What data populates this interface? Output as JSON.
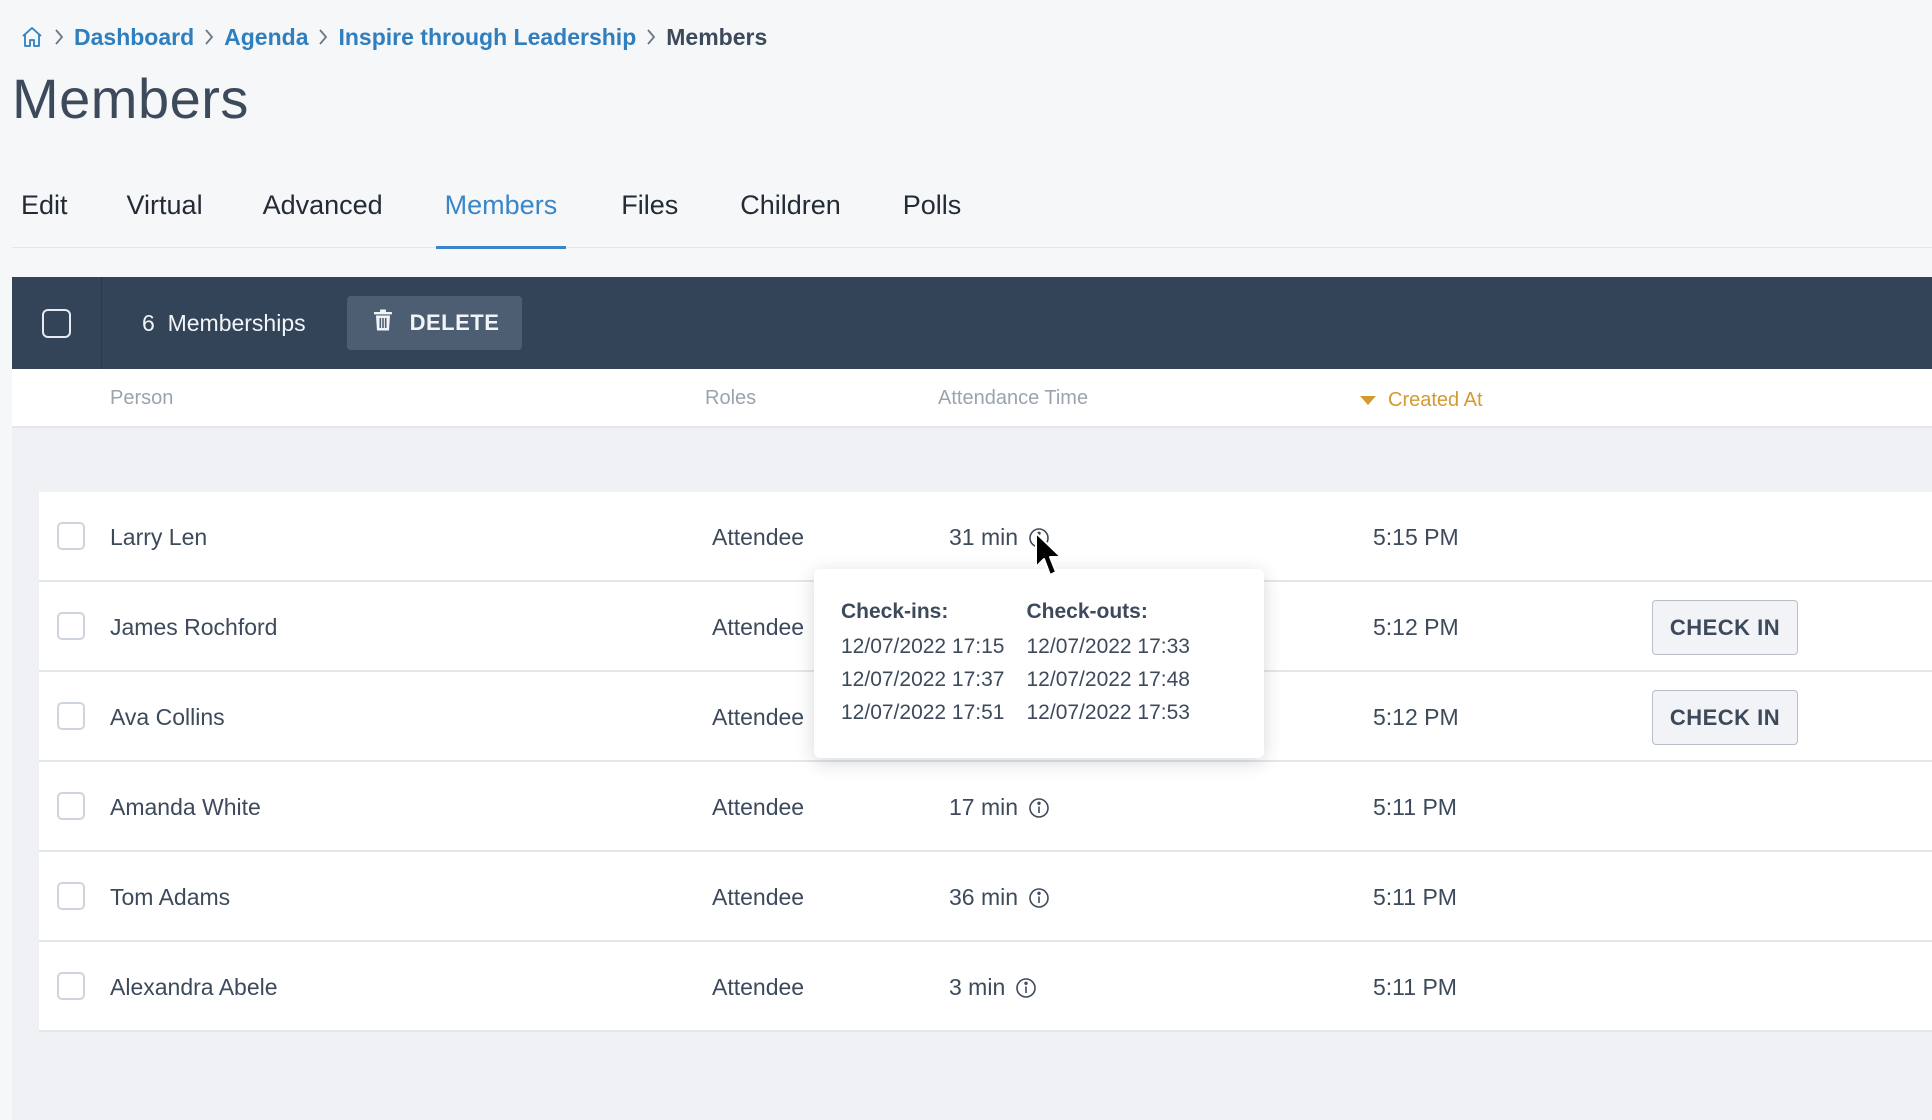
{
  "breadcrumb": {
    "home_icon": "home-icon",
    "items": [
      "Dashboard",
      "Agenda",
      "Inspire through Leadership"
    ],
    "current": "Members"
  },
  "page": {
    "title": "Members"
  },
  "tabs": [
    {
      "label": "Edit",
      "active": false
    },
    {
      "label": "Virtual",
      "active": false
    },
    {
      "label": "Advanced",
      "active": false
    },
    {
      "label": "Members",
      "active": true
    },
    {
      "label": "Files",
      "active": false
    },
    {
      "label": "Children",
      "active": false
    },
    {
      "label": "Polls",
      "active": false
    }
  ],
  "bulk_bar": {
    "count": "6",
    "count_label": "Memberships",
    "delete_label": "DELETE",
    "delete_icon": "trash-icon"
  },
  "columns": {
    "person": "Person",
    "roles": "Roles",
    "attendance": "Attendance Time",
    "created": "Created At",
    "created_sort": "descending"
  },
  "rows": [
    {
      "name": "Larry Len",
      "role": "Attendee",
      "attendance": "31 min",
      "created": "5:15 PM",
      "action": ""
    },
    {
      "name": "James Rochford",
      "role": "Attendee",
      "attendance": "",
      "created": "5:12 PM",
      "action": "CHECK IN"
    },
    {
      "name": "Ava Collins",
      "role": "Attendee",
      "attendance": "",
      "created": "5:12 PM",
      "action": "CHECK IN"
    },
    {
      "name": "Amanda White",
      "role": "Attendee",
      "attendance": "17 min",
      "created": "5:11 PM",
      "action": ""
    },
    {
      "name": "Tom Adams",
      "role": "Attendee",
      "attendance": "36 min",
      "created": "5:11 PM",
      "action": ""
    },
    {
      "name": "Alexandra Abele",
      "role": "Attendee",
      "attendance": "3 min",
      "created": "5:11 PM",
      "action": ""
    }
  ],
  "tooltip": {
    "checkins_label": "Check-ins:",
    "checkouts_label": "Check-outs:",
    "checkins": [
      "12/07/2022 17:15",
      "12/07/2022 17:37",
      "12/07/2022 17:51"
    ],
    "checkouts": [
      "12/07/2022 17:33",
      "12/07/2022 17:48",
      "12/07/2022 17:53"
    ]
  },
  "colors": {
    "accent": "#3a86c8",
    "bar": "#344458",
    "sort": "#d49a2f"
  }
}
